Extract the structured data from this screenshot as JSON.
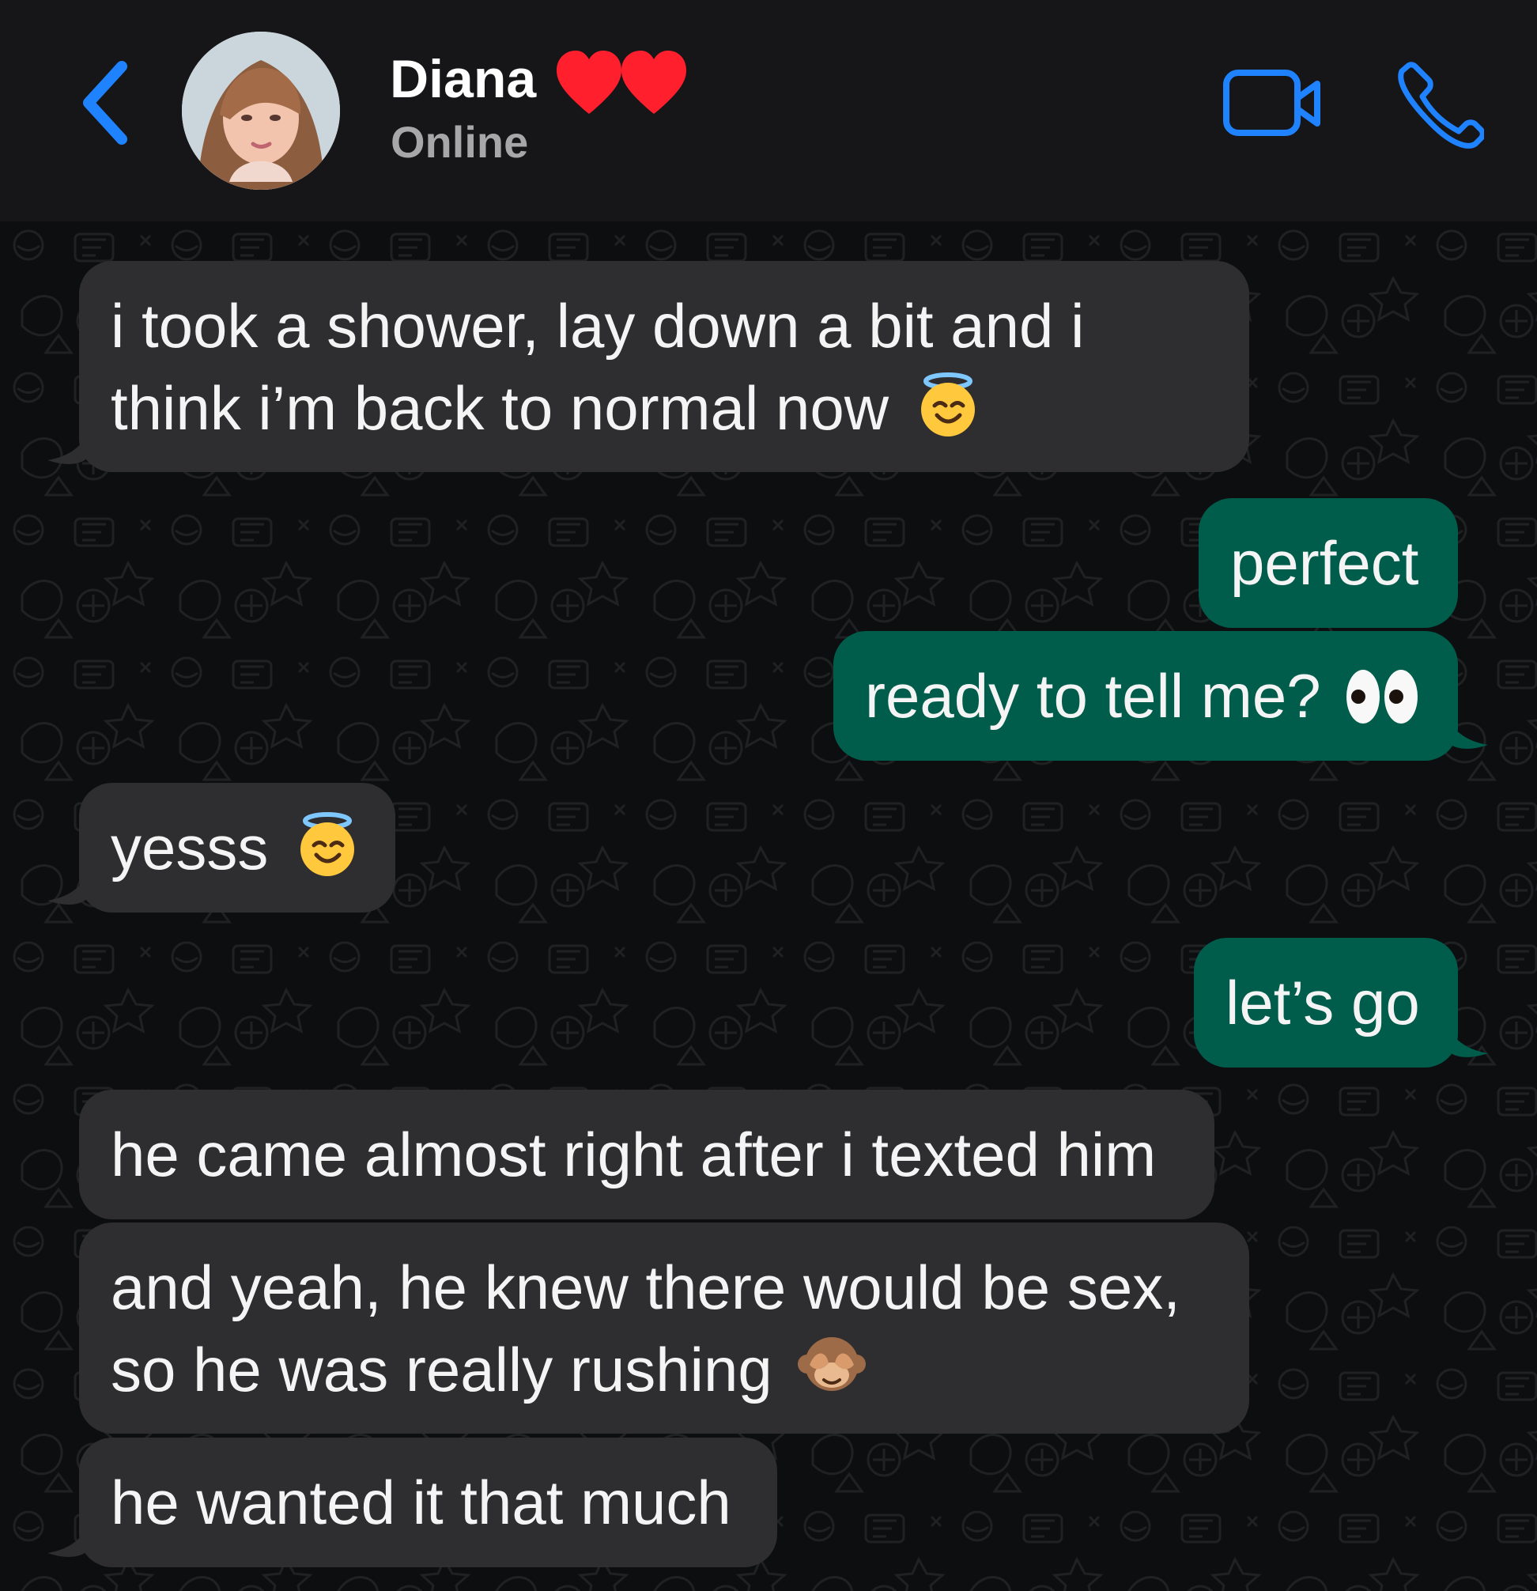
{
  "header": {
    "contact_name": "Diana",
    "name_emoji": "❤️❤️",
    "status": "Online",
    "back_icon": "chevron-left-icon",
    "video_icon": "video-camera-icon",
    "call_icon": "phone-icon"
  },
  "messages": [
    {
      "direction": "incoming",
      "lines": [
        "i took a shower, lay down a bit and i",
        "think i’m back to normal now"
      ],
      "emoji": "smiling-face-with-halo"
    },
    {
      "direction": "outgoing",
      "text": "perfect"
    },
    {
      "direction": "outgoing",
      "text": "ready to tell me?",
      "emoji": "eyes"
    },
    {
      "direction": "incoming",
      "text": "yesss",
      "emoji": "smiling-face-with-halo"
    },
    {
      "direction": "outgoing",
      "text": "let’s go"
    },
    {
      "direction": "incoming",
      "text": "he came almost right after i texted him"
    },
    {
      "direction": "incoming",
      "lines": [
        "and yeah, he knew there would be sex,",
        "so he was really rushing"
      ],
      "emoji": "see-no-evil-monkey"
    },
    {
      "direction": "incoming",
      "text": "he wanted it that much"
    }
  ],
  "colors": {
    "header_bg": "#161618",
    "chat_bg": "#0d0e10",
    "incoming_bubble": "#2e2e30",
    "outgoing_bubble": "#005c4b",
    "accent": "#1f83ff"
  }
}
